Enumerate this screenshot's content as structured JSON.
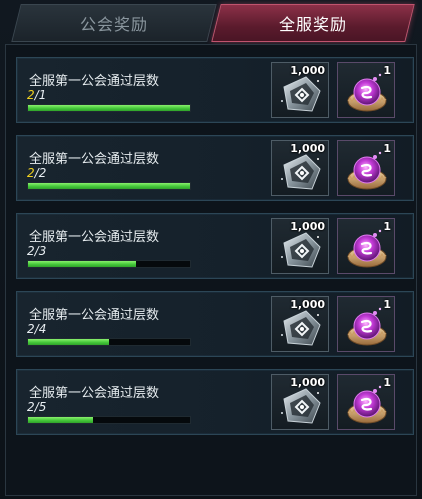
{
  "tabs": [
    {
      "label": "公会奖励",
      "active": false
    },
    {
      "label": "全服奖励",
      "active": true
    }
  ],
  "tasks": [
    {
      "title": "全服第一公会通过层数",
      "current": "2",
      "target": "1",
      "progress": 1.0,
      "completed": true,
      "rewards": [
        {
          "icon": "crystal-item-icon",
          "count": "1,000"
        },
        {
          "icon": "purple-bottlecap-icon",
          "count": "1"
        }
      ]
    },
    {
      "title": "全服第一公会通过层数",
      "current": "2",
      "target": "2",
      "progress": 1.0,
      "completed": true,
      "rewards": [
        {
          "icon": "crystal-item-icon",
          "count": "1,000"
        },
        {
          "icon": "purple-bottlecap-icon",
          "count": "1"
        }
      ]
    },
    {
      "title": "全服第一公会通过层数",
      "current": "2",
      "target": "3",
      "progress": 0.667,
      "completed": false,
      "rewards": [
        {
          "icon": "crystal-item-icon",
          "count": "1,000"
        },
        {
          "icon": "purple-bottlecap-icon",
          "count": "1"
        }
      ]
    },
    {
      "title": "全服第一公会通过层数",
      "current": "2",
      "target": "4",
      "progress": 0.5,
      "completed": false,
      "rewards": [
        {
          "icon": "crystal-item-icon",
          "count": "1,000"
        },
        {
          "icon": "purple-bottlecap-icon",
          "count": "1"
        }
      ]
    },
    {
      "title": "全服第一公会通过层数",
      "current": "2",
      "target": "5",
      "progress": 0.4,
      "completed": false,
      "rewards": [
        {
          "icon": "crystal-item-icon",
          "count": "1,000"
        },
        {
          "icon": "purple-bottlecap-icon",
          "count": "1"
        }
      ]
    }
  ],
  "colors": {
    "active_tab": "#8c3048",
    "progress_fill": "#45c83a",
    "highlight_number": "#f0d020"
  }
}
